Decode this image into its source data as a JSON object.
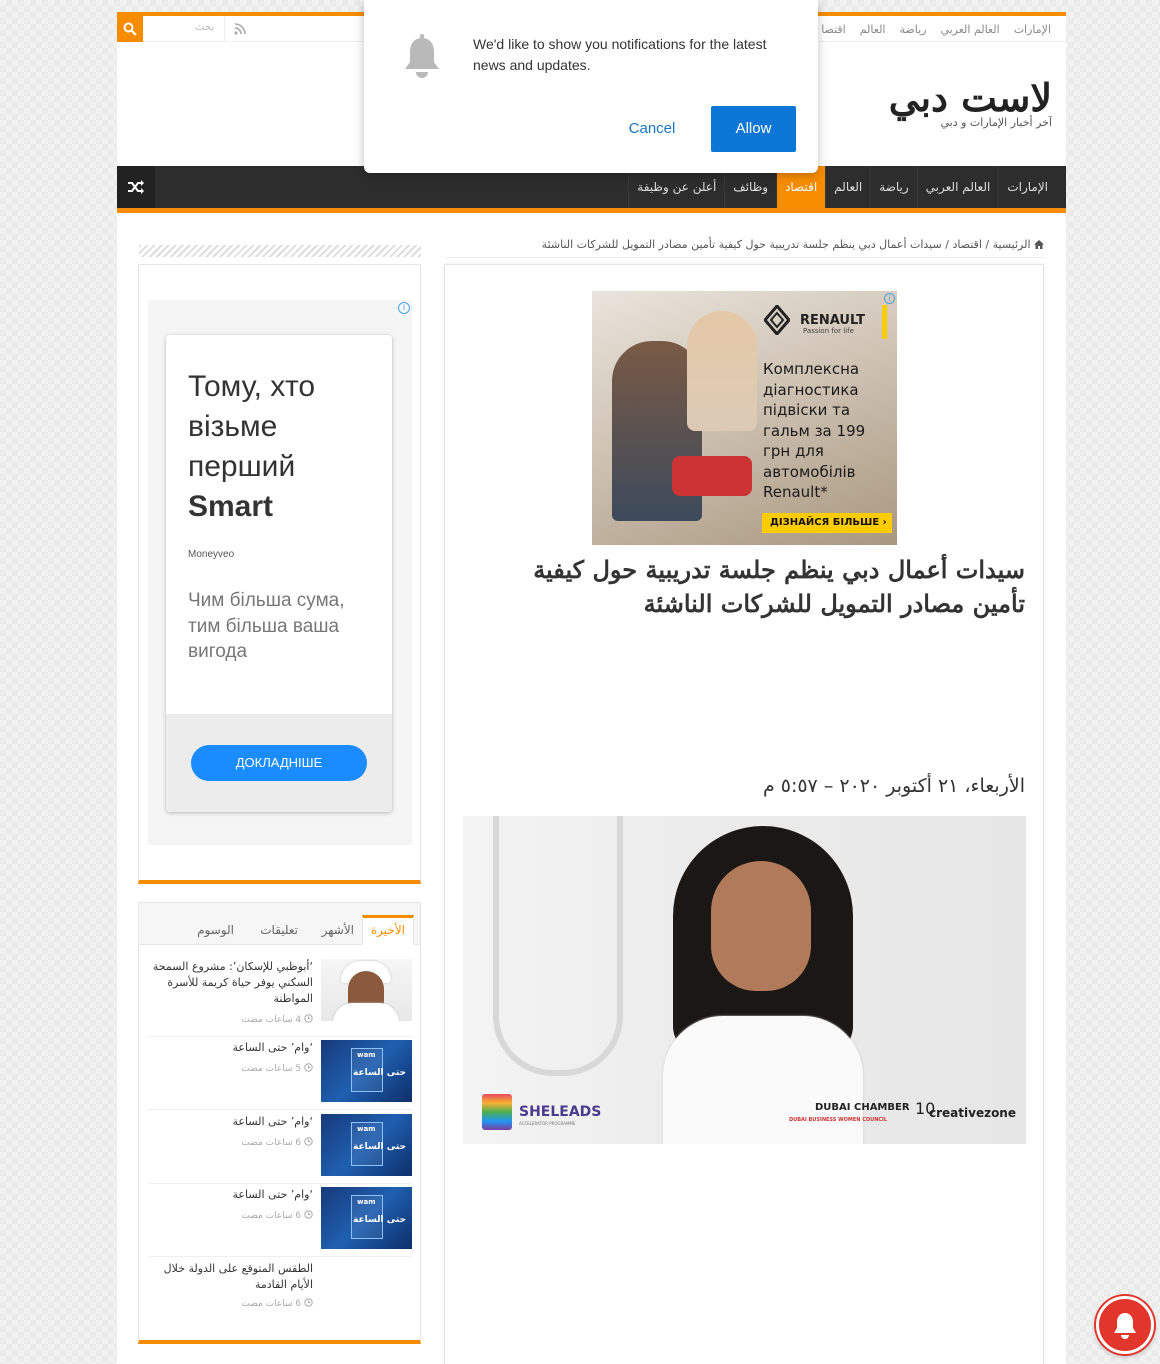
{
  "topbar": {
    "nav": [
      "الإمارات",
      "العالم العربي",
      "رياضة",
      "العالم",
      "اقتصا"
    ],
    "search_placeholder": "بحث"
  },
  "site": {
    "title": "لاست دبي",
    "tagline": "آخر أخبار الإمارات و دبي"
  },
  "mainnav": {
    "items": [
      "الإمارات",
      "العالم العربي",
      "رياضة",
      "العالم",
      "اقتصاد",
      "وظائف",
      "أعلن عن وظيفة"
    ],
    "active": "اقتصاد"
  },
  "breadcrumb": {
    "home": "الرئيسية",
    "section": "اقتصاد",
    "current": "سيدات أعمال دبي ينظم جلسة تدريبية حول كيفية تأمين مصادر التمويل للشركات الناشئة",
    "sep": "/"
  },
  "ad_top": {
    "brand": "RENAULT",
    "brand_tagline": "Passion for life",
    "copy": "Комплексна діагностика підвіски та гальм за 199 грн для автомобілів Renault*",
    "cta": "ДІЗНАЙСЯ БІЛЬШЕ  ›",
    "info": "i"
  },
  "article": {
    "title": "سيدات أعمال دبي ينظم جلسة تدريبية حول كيفية تأمين مصادر التمويل للشركات الناشئة",
    "date": "الأربعاء، ٢١ أكتوبر ٢٠٢٠ – ٥:٥٧ م",
    "image_logos": {
      "sheleads": "SHELEADS",
      "sheleads_sub": "ACCELERATOR PROGRAMME",
      "chamber": "DUBAI CHAMBER",
      "chamber_sub": "DUBAI BUSINESS WOMEN COUNCIL",
      "cz_num": "10",
      "cz": "creativezone"
    }
  },
  "side_ad": {
    "headline_pre": "Тому, хто візьме перший",
    "headline_bold": "Smart",
    "advertiser": "Moneyveo",
    "sub": "Чим більша сума, тим більша ваша вигода",
    "button": "ДОКЛАДНІШЕ",
    "info": "i"
  },
  "tabs": {
    "items": [
      "الأخيرة",
      "الأشهر",
      "تعليقات",
      "الوسوم"
    ],
    "active": "الأخيرة"
  },
  "posts": [
    {
      "title": "‘أبوظبي للإسكان’: مشروع السمحة السكني يوفر حياة كريمة للأسرة المواطنة",
      "time": "4 ساعات مضت",
      "thumb": "man"
    },
    {
      "title": "‘وام’ حتى الساعة",
      "time": "5 ساعات مضت",
      "thumb": "wam"
    },
    {
      "title": "‘وام’ حتى الساعة",
      "time": "6 ساعات مضت",
      "thumb": "wam"
    },
    {
      "title": "‘وام’ حتى الساعة",
      "time": "6 ساعات مضت",
      "thumb": "wam"
    },
    {
      "title": "الطقس المتوقع على الدولة خلال الأيام القادمة",
      "time": "6 ساعات مضت",
      "thumb": "none"
    }
  ],
  "wam_thumb": {
    "logo": "wam",
    "text": "حتى الساعة"
  },
  "notification": {
    "message": "We'd like to show you notifications for the latest news and updates.",
    "cancel": "Cancel",
    "allow": "Allow"
  },
  "colors": {
    "accent": "#f88c00",
    "nav_bg": "#2d2d2d",
    "allow_btn": "#0b76d6",
    "float_bell": "#e2362d"
  },
  "icons": [
    "search-icon",
    "rss-icon",
    "shuffle-icon",
    "home-icon",
    "clock-icon",
    "bell-icon",
    "info-icon"
  ]
}
